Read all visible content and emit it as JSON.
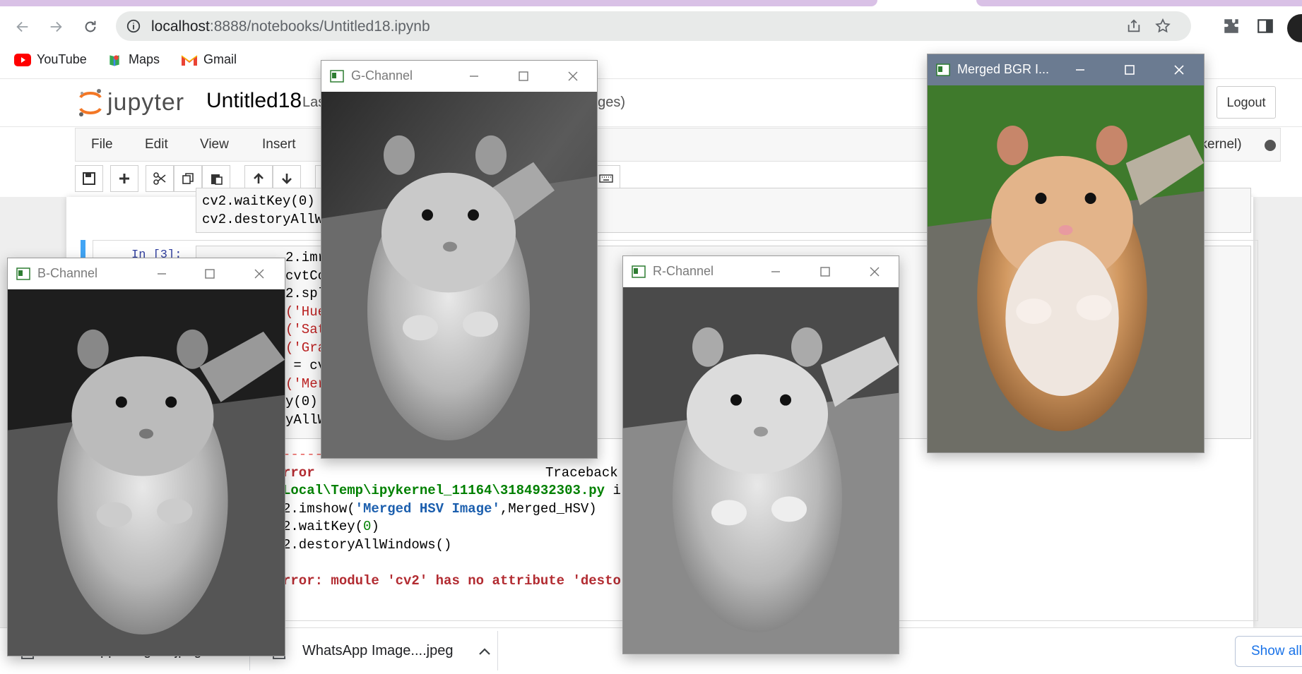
{
  "browser": {
    "url_host": "localhost",
    "url_path": ":8888/notebooks/Untitled18.ipynb",
    "bookmarks": [
      {
        "label": "YouTube",
        "icon": "youtube-icon"
      },
      {
        "label": "Maps",
        "icon": "maps-icon"
      },
      {
        "label": "Gmail",
        "icon": "gmail-icon"
      }
    ]
  },
  "jupyter": {
    "logo_text": "jupyter",
    "notebook_title": "Untitled18",
    "last_saved_fragment": "Las",
    "changes_fragment": "nges)",
    "logout_label": "Logout",
    "menu": [
      "File",
      "Edit",
      "View",
      "Insert"
    ],
    "kernel_fragment": "ykernel)"
  },
  "cells": {
    "cell1_lines": [
      "cv2.waitKey(0)",
      "cv2.destoryAllW"
    ],
    "cell2_prompt": "In [3]:",
    "cell2_lines": [
      {
        "pre": "",
        "text": "2.imr"
      },
      {
        "pre": "",
        "text": "cvtCo"
      },
      {
        "pre": "",
        "text": "2.spl"
      },
      {
        "pre": "",
        "text": "('Hue"
      },
      {
        "pre": "",
        "text": "('Sat"
      },
      {
        "pre": "",
        "text": "('Gra"
      },
      {
        "pre": "",
        "text": " = cv"
      },
      {
        "pre": "",
        "text": "('Mer"
      },
      {
        "pre": "",
        "text": "y(0)"
      },
      {
        "pre": "",
        "text": "yAllW"
      }
    ],
    "error": {
      "dashes": "-----------------------------------",
      "name": "rror",
      "traceback": "Traceback (",
      "path": "Local\\Temp\\ipykernel_11164\\3184932303.py",
      "path_suffix": " i",
      "line1_a": "2.imshow(",
      "line1_str": "'Merged HSV Image'",
      "line1_b": ",Merged_HSV)",
      "line2_a": "2.waitKey(",
      "line2_num": "0",
      "line2_b": ")",
      "line3": "2.destoryAllWindows()",
      "message": "rror: module 'cv2' has no attribute 'desto"
    }
  },
  "windows": {
    "g_channel": "G-Channel",
    "b_channel": "B-Channel",
    "r_channel": "R-Channel",
    "merged": "Merged BGR I..."
  },
  "downloads": {
    "item1": "WhatsApp Image....jpeg",
    "item2": "WhatsApp Image....jpeg",
    "show_all": "Show all"
  },
  "colors": {
    "tab_accent": "#d9c1e6",
    "active_titlebar": "#6b7b91",
    "cell_marker": "#42a5f5",
    "error_red": "#b22b31",
    "link_blue": "#1a73e8"
  }
}
